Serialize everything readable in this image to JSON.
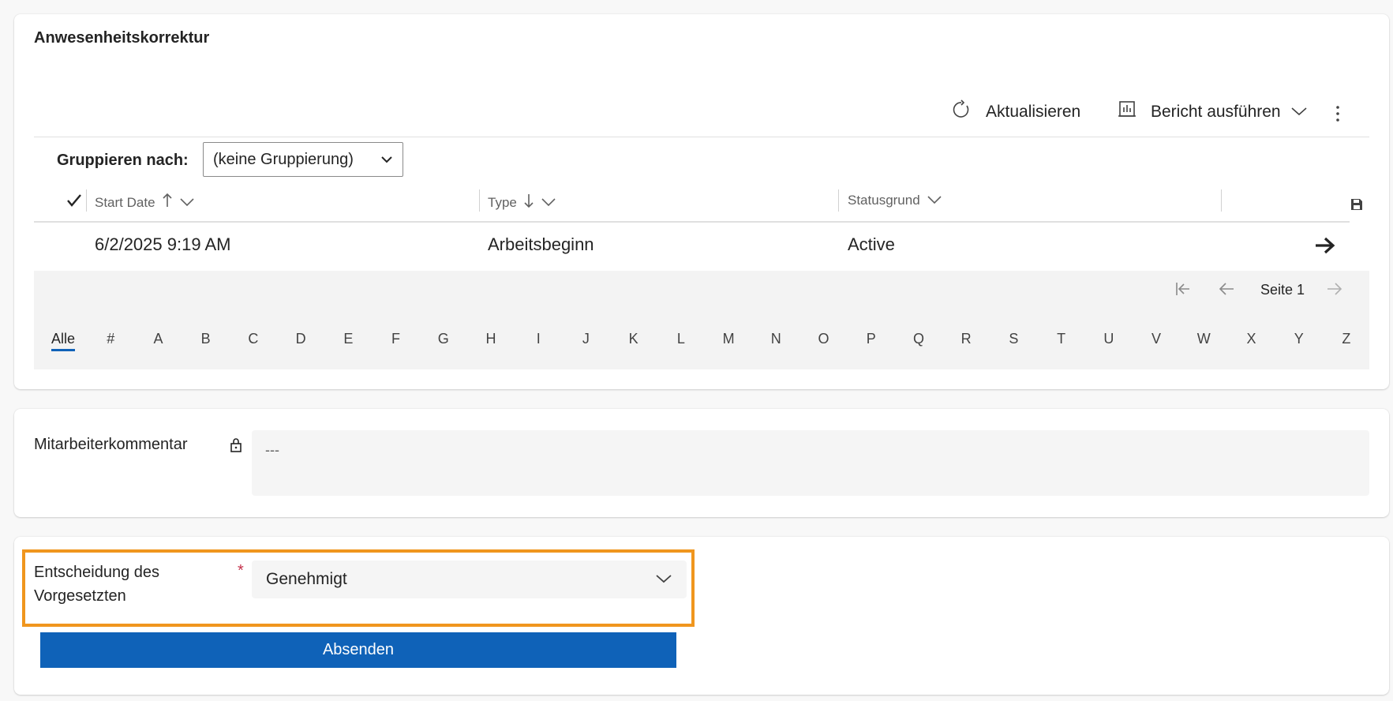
{
  "section": {
    "title": "Anwesenheitskorrektur"
  },
  "toolbar": {
    "refresh_label": "Aktualisieren",
    "run_report_label": "Bericht ausführen"
  },
  "groupby": {
    "label": "Gruppieren nach:",
    "value": "(keine Gruppierung)"
  },
  "table": {
    "columns": [
      {
        "label": "Start Date",
        "sort": "ascending"
      },
      {
        "label": "Type",
        "sort": "descending"
      },
      {
        "label": "Statusgrund",
        "sort": "none"
      }
    ],
    "rows": [
      {
        "start_date": "6/2/2025 9:19 AM",
        "type": "Arbeitsbeginn",
        "status": "Active"
      }
    ]
  },
  "pager": {
    "page_label": "Seite 1"
  },
  "alphabet": {
    "active": "Alle",
    "letters": [
      "Alle",
      "#",
      "A",
      "B",
      "C",
      "D",
      "E",
      "F",
      "G",
      "H",
      "I",
      "J",
      "K",
      "L",
      "M",
      "N",
      "O",
      "P",
      "Q",
      "R",
      "S",
      "T",
      "U",
      "V",
      "W",
      "X",
      "Y",
      "Z"
    ]
  },
  "comment": {
    "label": "Mitarbeiterkommentar",
    "value": "---"
  },
  "decision": {
    "label_line1": "Entscheidung des",
    "label_line2": "Vorgesetzten",
    "required_mark": "*",
    "value": "Genehmigt"
  },
  "submit": {
    "label": "Absenden"
  },
  "colors": {
    "accent": "#0f62b8",
    "highlight": "#f0961e",
    "required": "#c4314b"
  }
}
